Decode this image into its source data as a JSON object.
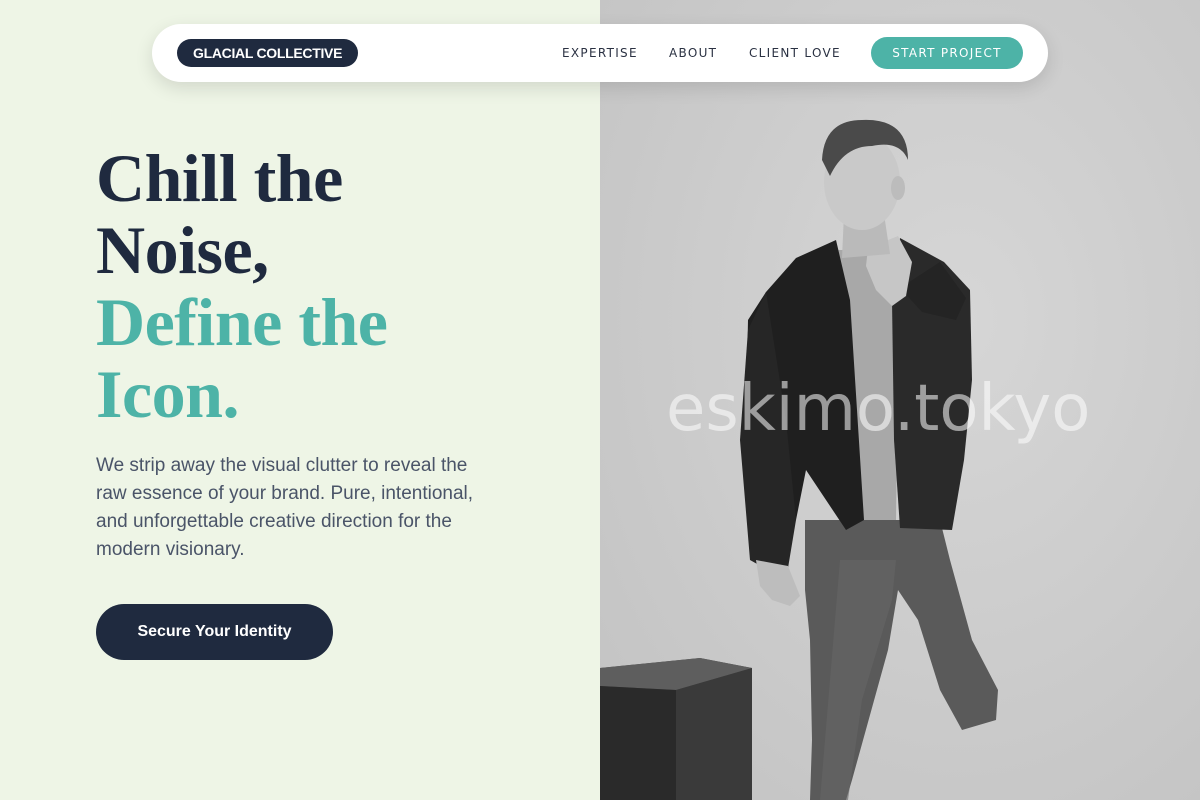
{
  "nav": {
    "brand": "GLACIAL COLLECTIVE",
    "links": [
      "EXPERTISE",
      "ABOUT",
      "CLIENT LOVE"
    ],
    "cta": "START PROJECT"
  },
  "hero": {
    "headline_line1": "Chill the",
    "headline_line2": "Noise,",
    "headline_line3": "Define the",
    "headline_line4": "Icon.",
    "subtext": "We strip away the visual clutter to reveal the raw essence of your brand. Pure, intentional, and unforgettable creative direction for the modern visionary.",
    "button": "Secure Your Identity"
  },
  "photo": {
    "watermark": "eskimo.tokyo"
  },
  "colors": {
    "navy": "#1f2a3f",
    "teal": "#4db3a7",
    "mint_background": "#eef5e6",
    "photo_gray": "#cbcbcb"
  }
}
